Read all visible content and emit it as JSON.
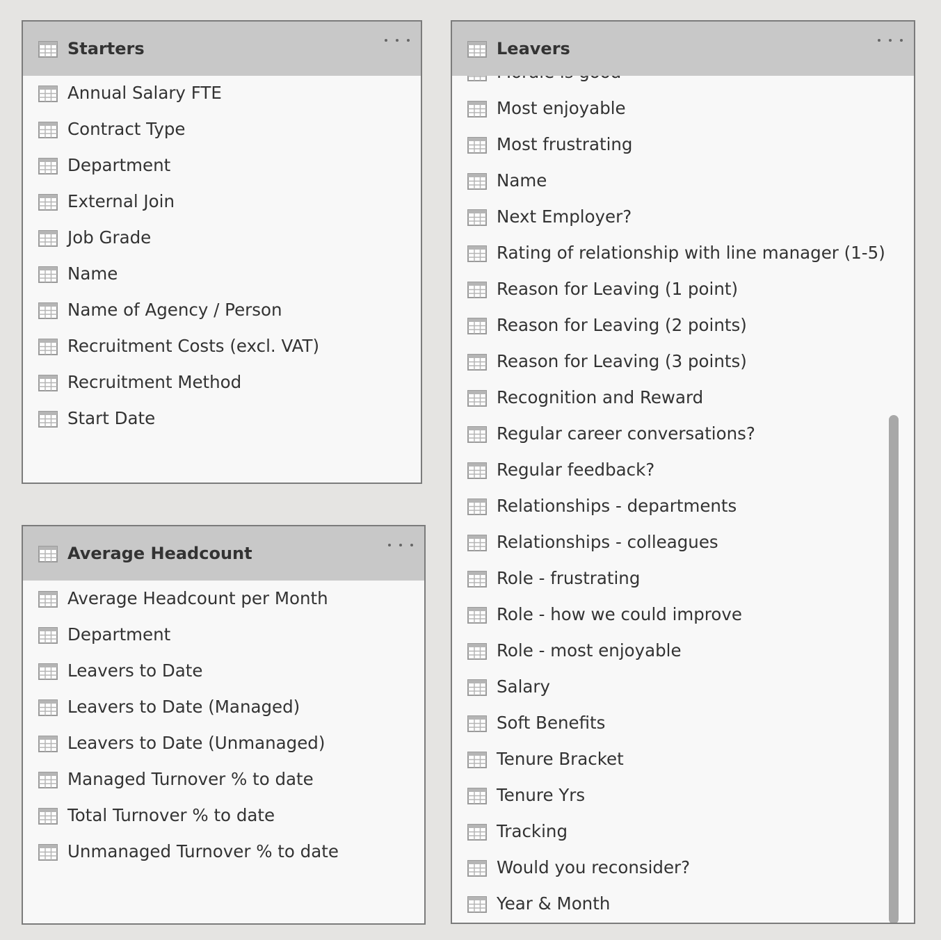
{
  "tables": [
    {
      "id": "starters",
      "title": "Starters",
      "header_icon": "table-icon",
      "more_icon": "ellipsis-icon",
      "fields": [
        "Annual Salary FTE",
        "Contract Type",
        "Department",
        "External Join",
        "Job Grade",
        "Name",
        "Name of Agency / Person",
        "Recruitment Costs (excl. VAT)",
        "Recruitment Method",
        "Start Date"
      ]
    },
    {
      "id": "headcount",
      "title": "Average Headcount",
      "header_icon": "table-icon",
      "more_icon": "ellipsis-icon",
      "fields": [
        "Average Headcount per Month",
        "Department",
        "Leavers to Date",
        "Leavers to Date (Managed)",
        "Leavers to Date (Unmanaged)",
        "Managed Turnover % to date",
        "Total Turnover % to date",
        "Unmanaged Turnover % to date"
      ]
    },
    {
      "id": "leavers",
      "title": "Leavers",
      "header_icon": "table-icon",
      "more_icon": "ellipsis-icon",
      "fields": [
        "Morale is good",
        "Most enjoyable",
        "Most frustrating",
        "Name",
        "Next Employer?",
        "Rating of relationship with line manager (1-5)",
        "Reason for Leaving (1 point)",
        "Reason for Leaving (2 points)",
        "Reason for Leaving (3 points)",
        "Recognition and Reward",
        "Regular career conversations?",
        "Regular feedback?",
        "Relationships - departments",
        "Relationships - colleagues",
        "Role - frustrating",
        "Role - how we could improve",
        "Role - most enjoyable",
        "Salary",
        "Soft Benefits",
        "Tenure Bracket",
        "Tenure Yrs",
        "Tracking",
        "Would you reconsider?",
        "Year & Month"
      ]
    }
  ]
}
